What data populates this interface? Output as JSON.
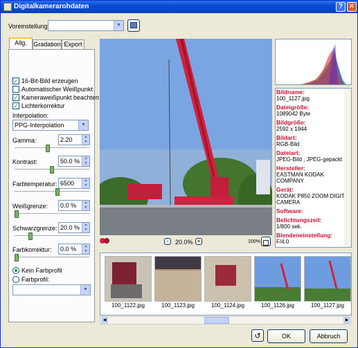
{
  "window": {
    "title": "Digitalkamerarohdaten",
    "help_label": "?",
    "close_label": "✕"
  },
  "preset": {
    "label": "Voreinstellung:",
    "value": "",
    "save_icon": "disk-icon"
  },
  "tabs": [
    {
      "label": "Allg."
    },
    {
      "label": "Gradation"
    },
    {
      "label": "Export"
    }
  ],
  "options": {
    "bit16": {
      "label": "16-Bit-Bild erzeugen",
      "checked": true
    },
    "auto_wb": {
      "label": "Automatischer Weißpunkt",
      "checked": false
    },
    "camera_wb": {
      "label": "Kameraweißpunkt beachten",
      "checked": true
    },
    "light_corr": {
      "label": "Lichterkorrektur",
      "checked": true
    }
  },
  "interpolation": {
    "label": "Interpolation:",
    "value": "PPG-Interpolation"
  },
  "sliders": {
    "gamma": {
      "label": "Gamma:",
      "value": "2.20",
      "level": 0.44
    },
    "contrast": {
      "label": "Kontrast:",
      "value": "50.0 %",
      "level": 0.5
    },
    "color_temp": {
      "label": "Farbtemperatur:",
      "value": "6500",
      "level": 0.58
    },
    "white_limit": {
      "label": "Weißgrenze:",
      "value": "0.0 %",
      "level": 0.0
    },
    "black_limit": {
      "label": "Schwarzgrenze:",
      "value": "20.0 %",
      "level": 0.2
    },
    "color_corr": {
      "label": "Farbkorrektur:",
      "value": "0.0 %",
      "level": 0.0
    }
  },
  "profile": {
    "none_label": "Kein Farbprofil",
    "profile_label": "Farbprofil:",
    "none_selected": true,
    "profile_value": ""
  },
  "zoom": {
    "value": "20.0%",
    "reset_label": "100%",
    "minus": "-",
    "plus": "+"
  },
  "info": [
    {
      "key": "Bildname:",
      "value": "100_1127.jpg"
    },
    {
      "key": "Dateigröße:",
      "value": "1089042 Byte"
    },
    {
      "key": "Bildgröße:",
      "value": "2592 x 1944"
    },
    {
      "key": "Bildart:",
      "value": "RGB-Bild"
    },
    {
      "key": "Dateiart:",
      "value": "JPEG-Bild , JPEG-gepackt"
    },
    {
      "key": "Hersteller:",
      "value": "EASTMAN KODAK COMPANY"
    },
    {
      "key": "Gerät:",
      "value": "KODAK P850 ZOOM DIGITAL CAMERA"
    },
    {
      "key": "Software:",
      "value": ""
    },
    {
      "key": "Belichtungszeit:",
      "value": "1/800 sek."
    },
    {
      "key": "Blendeneinstellung:",
      "value": "F/4.0"
    }
  ],
  "thumbnails": [
    {
      "name": "100_1122.jpg"
    },
    {
      "name": "100_1123.jpg"
    },
    {
      "name": "100_1124.jpg"
    },
    {
      "name": "100_1126.jpg"
    },
    {
      "name": "100_1127.jpg"
    }
  ],
  "buttons": {
    "ok": "OK",
    "cancel": "Abbruch",
    "reset_icon": "undo-icon"
  },
  "colors": {
    "title_bar": "#0a4bd1",
    "info_key": "#c8102e",
    "crane_red": "#d0213f"
  }
}
